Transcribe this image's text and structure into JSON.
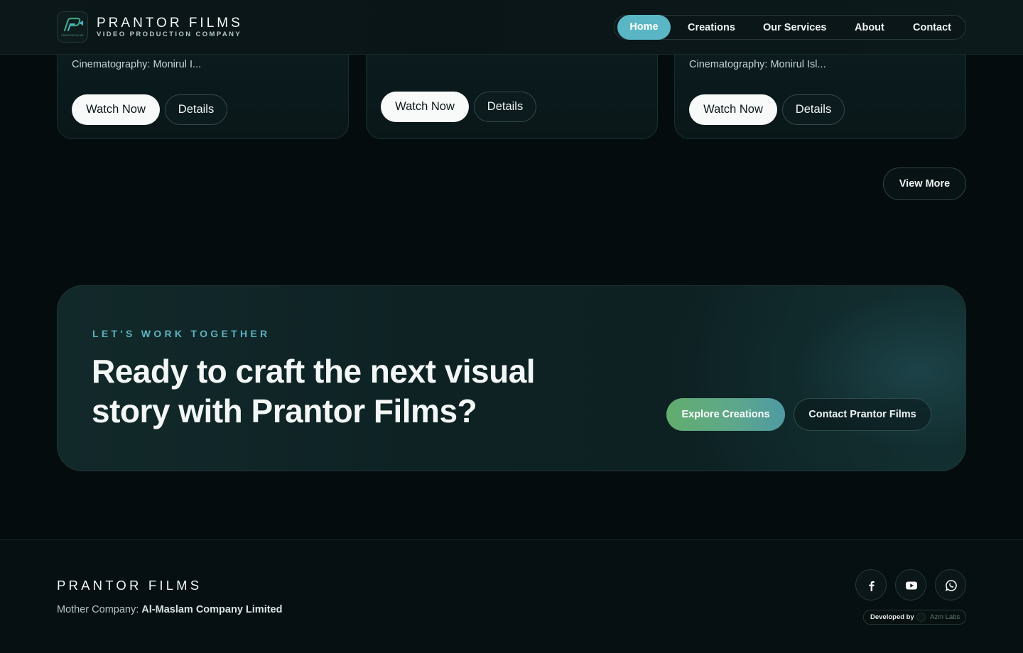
{
  "header": {
    "brand_name": "PRANTOR FILMS",
    "brand_tagline": "VIDEO PRODUCTION COMPANY",
    "logo_mini_text": "PRANTOR FILMS",
    "nav": [
      {
        "label": "Home",
        "active": true
      },
      {
        "label": "Creations",
        "active": false
      },
      {
        "label": "Our Services",
        "active": false
      },
      {
        "label": "About",
        "active": false
      },
      {
        "label": "Contact",
        "active": false
      }
    ]
  },
  "cards": [
    {
      "credit": "Cinematography: Monirul I...",
      "watch_label": "Watch Now",
      "details_label": "Details"
    },
    {
      "credit": "",
      "watch_label": "Watch Now",
      "details_label": "Details"
    },
    {
      "credit": "Cinematography: Monirul Isl...",
      "watch_label": "Watch Now",
      "details_label": "Details"
    }
  ],
  "view_more_label": "View More",
  "cta": {
    "eyebrow": "LET'S WORK TOGETHER",
    "title": "Ready to craft the next visual story with Prantor Films?",
    "explore_label": "Explore Creations",
    "contact_label": "Contact Prantor Films"
  },
  "footer": {
    "brand": "PRANTOR FILMS",
    "company_prefix": "Mother Company: ",
    "company_name": "Al-Maslam Company Limited",
    "socials": [
      "facebook-icon",
      "youtube-icon",
      "whatsapp-icon"
    ],
    "developed_by_label": "Developed by",
    "developer_name": "Azm Labs"
  },
  "colors": {
    "background": "#050c0e",
    "accent_teal": "#5ab6c4",
    "accent_green": "#62ad6e"
  }
}
